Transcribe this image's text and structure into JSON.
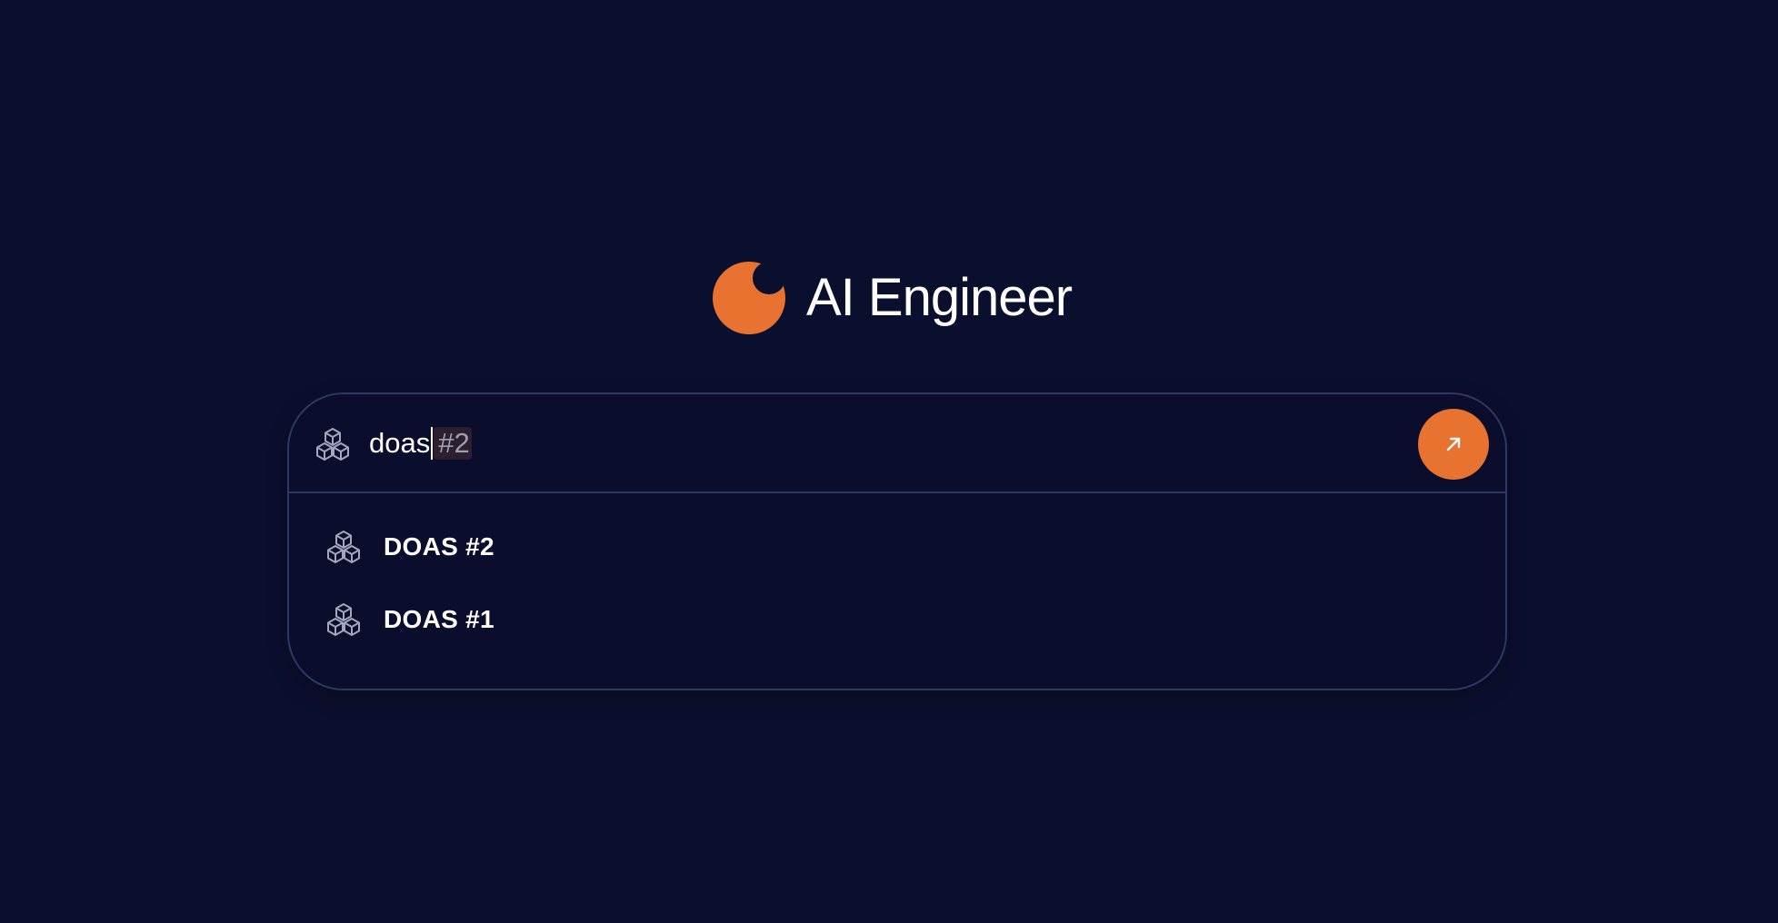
{
  "brand": {
    "title": "AI Engineer",
    "logo_icon": "orange-crescent-logo",
    "accent_color": "#e8722f"
  },
  "search": {
    "typed_value": "doas",
    "autocomplete_suggestion": "#2",
    "leading_icon": "cubes-icon",
    "submit_icon": "arrow-up-right-icon"
  },
  "results": [
    {
      "label": "DOAS #2",
      "icon": "cubes-icon"
    },
    {
      "label": "DOAS #1",
      "icon": "cubes-icon"
    }
  ],
  "colors": {
    "background": "#0b0f2e",
    "border": "#2f3763",
    "accent": "#e8722f",
    "icon": "#a3a7bd"
  }
}
